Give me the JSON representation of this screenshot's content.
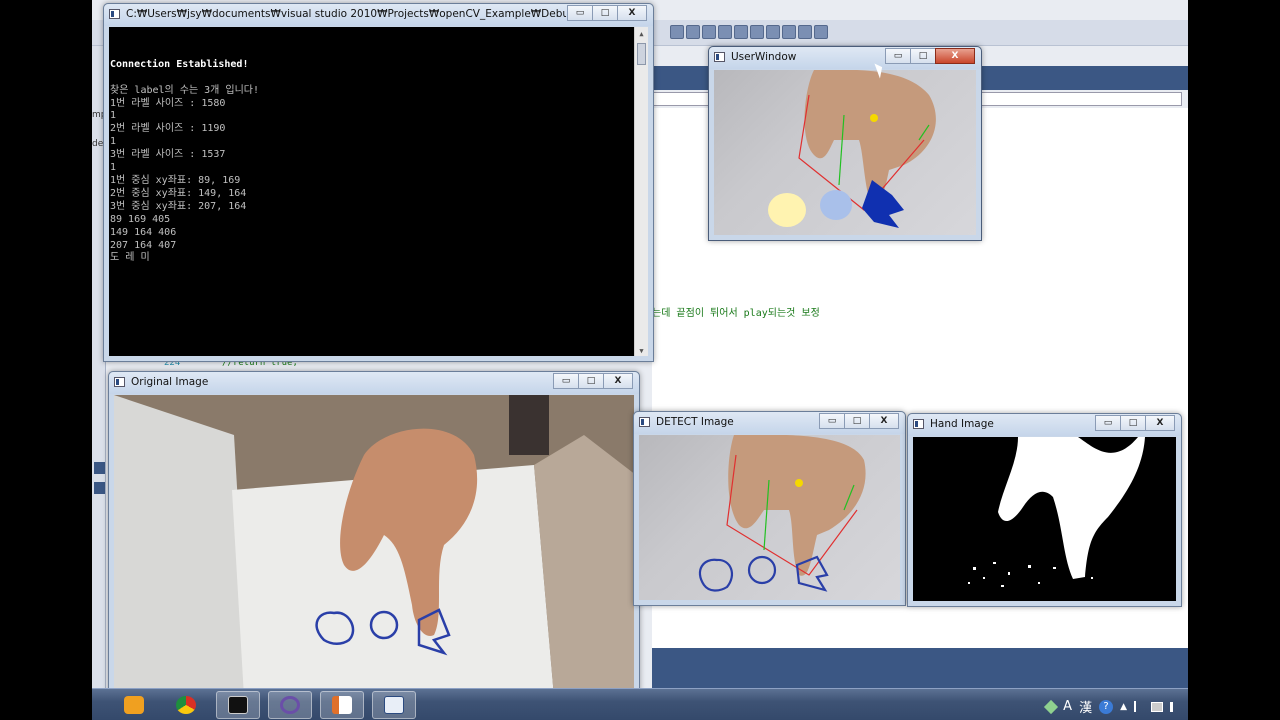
{
  "console": {
    "title": "C:₩Users₩jsy₩documents₩visual studio 2010₩Projects₩openCV_Example₩Debug₩openCV_Exa...",
    "lines": [
      "Connection Established!",
      "",
      "찾은 label의 수는 3개 입니다!",
      "1번 라벨 사이즈 : 1580",
      "1",
      "2번 라벨 사이즈 : 1190",
      "1",
      "3번 라벨 사이즈 : 1537",
      "1",
      "1번 중심 xy좌표: 89, 169",
      "2번 중심 xy좌표: 149, 164",
      "3번 중심 xy좌표: 207, 164",
      "89 169 405",
      "149 164 406",
      "207 164 407",
      "도 레 미"
    ]
  },
  "windows": {
    "user_window": "UserWindow",
    "original_image": "Original Image",
    "detect_image": "DETECT Image",
    "hand_image": "Hand Image"
  },
  "window_controls": {
    "minimize": "▭",
    "maximize": "□",
    "close": "X"
  },
  "background_editor": {
    "comment": "는데 끝점이 튀어서 play되는것 보정",
    "code_fragment": "//return true;",
    "line_number": "224",
    "left_fragments": [
      "mp",
      "de"
    ]
  },
  "taskbar": {
    "apps": [
      {
        "name": "media-player",
        "color": "#f0a020"
      },
      {
        "name": "chrome",
        "color": "#4a9d4a"
      },
      {
        "name": "console",
        "color": "#111111"
      },
      {
        "name": "visual-studio",
        "color": "#6a4fa8"
      },
      {
        "name": "presentation",
        "color": "#e0702a"
      },
      {
        "name": "opencv-window",
        "color": "#e8eef7"
      }
    ],
    "tray": {
      "ime_a": "A",
      "ime_han": "漢",
      "help": "?",
      "caret": "▲"
    }
  },
  "colors": {
    "console_bg": "#000000",
    "console_text": "#c0c0c0",
    "hull_red": "#e03030",
    "finger_green": "#22c022",
    "centroid_yellow": "#f5d800",
    "note_blue": "#1030b0",
    "drawing_blue": "#2a3fa8"
  }
}
